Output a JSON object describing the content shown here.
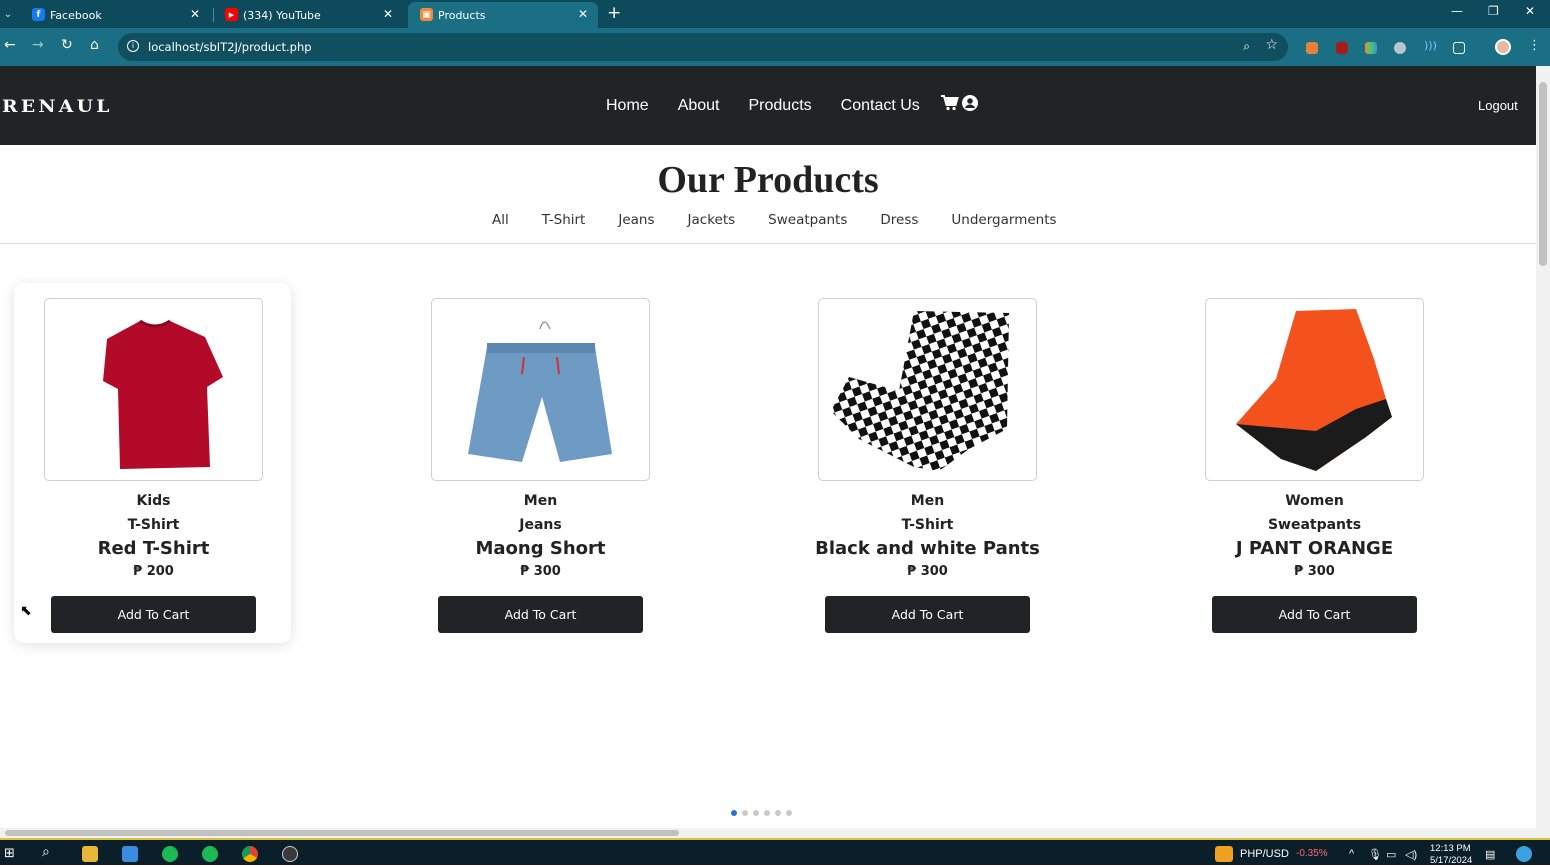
{
  "browser": {
    "tabs": [
      {
        "label": "Facebook",
        "icon": "facebook-icon"
      },
      {
        "label": "(334) YouTube",
        "icon": "youtube-icon"
      },
      {
        "label": "Products",
        "icon": "products-favicon"
      }
    ],
    "url": "localhost/sbIT2J/product.php"
  },
  "site": {
    "logo": "RENAUL",
    "nav": [
      "Home",
      "About",
      "Products",
      "Contact Us"
    ],
    "logout": "Logout"
  },
  "page": {
    "title": "Our Products",
    "filters": [
      "All",
      "T-Shirt",
      "Jeans",
      "Jackets",
      "Sweatpants",
      "Dress",
      "Undergarments"
    ],
    "products": [
      {
        "cat1": "Kids",
        "cat2": "T-Shirt",
        "name": "Red T-Shirt",
        "price": "₱ 200",
        "button": "Add To Cart"
      },
      {
        "cat1": "Men",
        "cat2": "Jeans",
        "name": "Maong Short",
        "price": "₱ 300",
        "button": "Add To Cart"
      },
      {
        "cat1": "Men",
        "cat2": "T-Shirt",
        "name": "Black and white Pants",
        "price": "₱ 300",
        "button": "Add To Cart"
      },
      {
        "cat1": "Women",
        "cat2": "Sweatpants",
        "name": "J PANT ORANGE",
        "price": "₱ 300",
        "button": "Add To Cart"
      }
    ],
    "carousel_active": 1,
    "carousel_count": 6
  },
  "taskbar": {
    "currency": "PHP/USD",
    "change": "-0.35%",
    "time": "12:13 PM",
    "date": "5/17/2024"
  },
  "colors": {
    "tabbar": "#0d4a5c",
    "navbar": "#212427",
    "accent": "#2a6fd6"
  }
}
